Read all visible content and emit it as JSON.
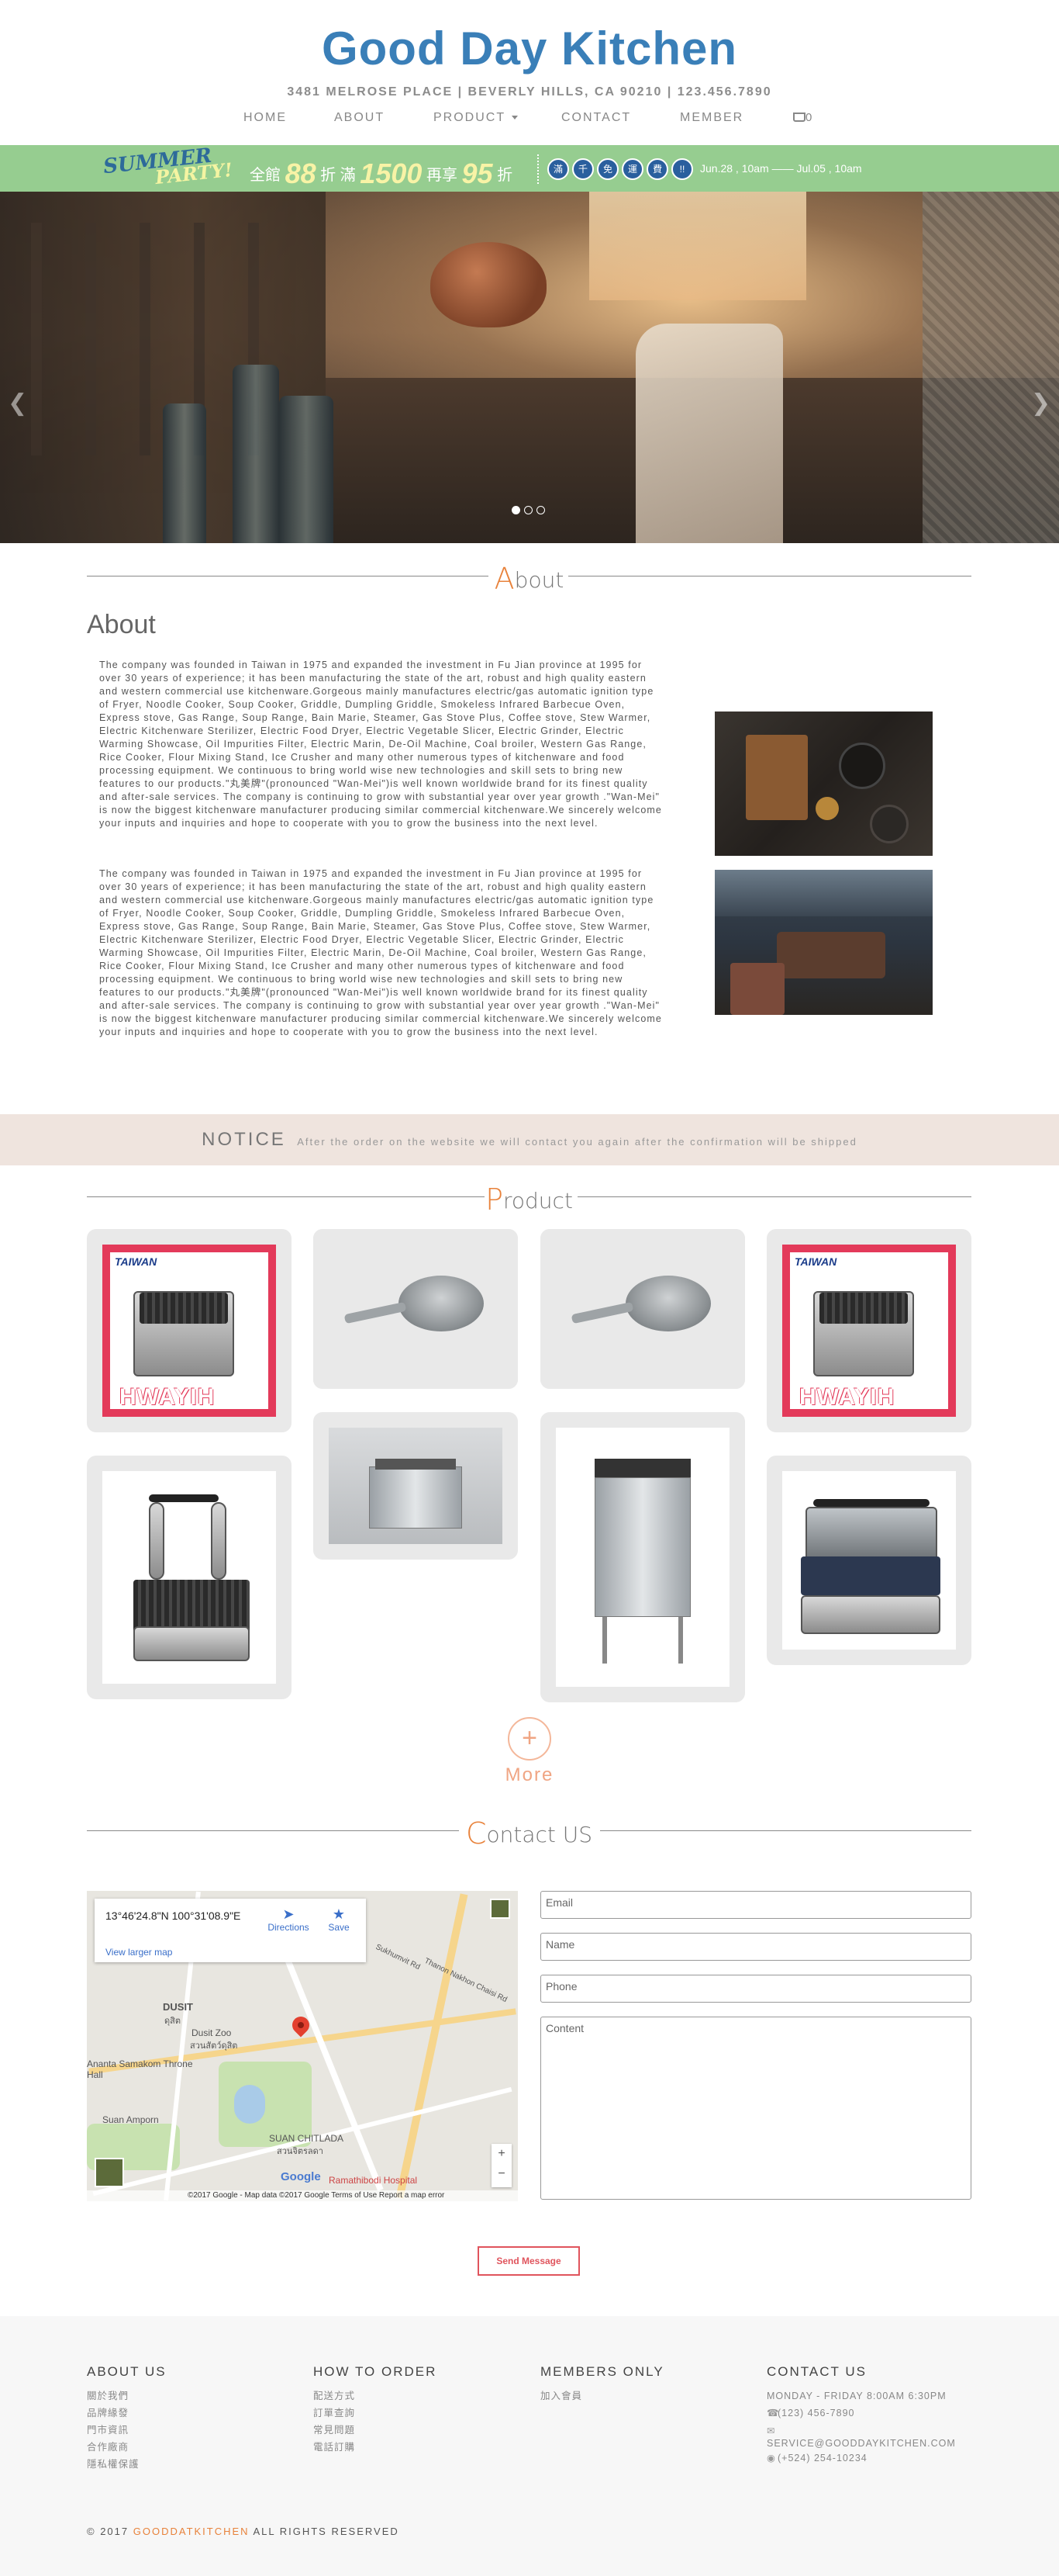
{
  "header": {
    "brand": "Good Day Kitchen",
    "address": "3481 MELROSE PLACE | BEVERLY HILLS, CA 90210 | 123.456.7890",
    "nav": [
      "HOME",
      "ABOUT",
      "PRODUCT",
      "CONTACT",
      "MEMBER"
    ],
    "cart_count": "0"
  },
  "promo": {
    "summer": "SUMMER",
    "party": "PARTY!",
    "t1": "全館",
    "n1": "88",
    "t2": "折",
    "t3": "滿",
    "n2": "1500",
    "t4": "再享",
    "n3": "95",
    "t5": "折",
    "badges": [
      "滿",
      "千",
      "免",
      "運",
      "費",
      "!!"
    ],
    "dates": "Jun.28 , 10am —— Jul.05 , 10am"
  },
  "hero": {
    "slide_count": 3,
    "active_slide": 1
  },
  "about": {
    "section_cap": "A",
    "section_rest": "bout",
    "heading": "About",
    "paragraphs": [
      "The company was founded in Taiwan in 1975 and expanded the investment in Fu Jian province at 1995 for over 30 years of experience; it has been manufacturing the state of the art, robust and high quality eastern and western commercial use kitchenware.Gorgeous mainly manufactures electric/gas automatic ignition type of Fryer, Noodle Cooker, Soup Cooker, Griddle, Dumpling Griddle, Smokeless Infrared Barbecue Oven, Express stove, Gas Range, Soup Range, Bain Marie, Steamer, Gas Stove Plus, Coffee stove, Stew Warmer, Electric Kitchenware Sterilizer, Electric Food Dryer, Electric Vegetable Slicer, Electric Grinder, Electric Warming Showcase, Oil Impurities Filter, Electric Marin, De-Oil Machine, Coal broiler, Western Gas Range, Rice Cooker, Flour Mixing Stand, Ice Crusher and many other numerous types of kitchenware and food processing equipment. We continuous to bring world wise new technologies and skill sets to bring new features to our products.\"丸美牌\"(pronounced \"Wan-Mei\")is well known worldwide brand for its finest quality and after-sale services. The company is continuing to grow with substantial year over year growth .\"Wan-Mei\" is now the biggest kitchenware manufacturer producing similar commercial kitchenware.We sincerely welcome your inputs and inquiries and hope to cooperate with you to grow the business into the next level.",
      "The company was founded in Taiwan in 1975 and expanded the investment in Fu Jian province at 1995 for over 30 years of experience; it has been manufacturing the state of the art, robust and high quality eastern and western commercial use kitchenware.Gorgeous mainly manufactures electric/gas automatic ignition type of Fryer, Noodle Cooker, Soup Cooker, Griddle, Dumpling Griddle, Smokeless Infrared Barbecue Oven, Express stove, Gas Range, Soup Range, Bain Marie, Steamer, Gas Stove Plus, Coffee stove, Stew Warmer, Electric Kitchenware Sterilizer, Electric Food Dryer, Electric Vegetable Slicer, Electric Grinder, Electric Warming Showcase, Oil Impurities Filter, Electric Marin, De-Oil Machine, Coal broiler, Western Gas Range, Rice Cooker, Flour Mixing Stand, Ice Crusher and many other numerous types of kitchenware and food processing equipment. We continuous to bring world wise new technologies and skill sets to bring new features to our products.\"丸美牌\"(pronounced \"Wan-Mei\")is well known worldwide brand for its finest quality and after-sale services. The company is continuing to grow with substantial year over year growth .\"Wan-Mei\" is now the biggest kitchenware manufacturer producing similar commercial kitchenware.We sincerely welcome your inputs and inquiries and hope to cooperate with you to grow the business into the next level."
    ]
  },
  "notice": {
    "title": "NOTICE",
    "text": "After the order on the website we will contact you again after the confirmation will be shipped"
  },
  "product": {
    "section_cap": "P",
    "section_rest": "roduct",
    "taiwan_logo": "TAIWAN",
    "hwayih_logo": "HWAYIH",
    "more_symbol": "+",
    "more_label": "More"
  },
  "contact": {
    "section_cap": "C",
    "section_rest": "ontact US",
    "map": {
      "coords": "13°46'24.8\"N 100°31'08.9\"E",
      "larger": "View larger map",
      "directions": "Directions",
      "save": "Save",
      "labels": [
        "DUSIT",
        "ดุสิต",
        "Dusit Zoo",
        "สวนสัตว์ดุสิต",
        "Ananta Samakom Throne Hall",
        "Suan Amporn",
        "SUAN CHITLADA",
        "สวนจิตรลดา",
        "Ramathibodi Hospital",
        "Sukhumvit Rd",
        "Thanon Nakhon Chaisi Rd"
      ],
      "google": "Google",
      "footer": "©2017 Google - Map data ©2017 Google    Terms of Use    Report a map error"
    },
    "fields": {
      "email": "Email",
      "name": "Name",
      "phone": "Phone",
      "content": "Content"
    },
    "send": "Send Message"
  },
  "footer": {
    "cols": [
      {
        "title": "ABOUT US",
        "links": [
          "關於我們",
          "品牌緣發",
          "門市資訊",
          "合作廠商",
          "隱私權保護"
        ]
      },
      {
        "title": "HOW TO ORDER",
        "links": [
          "配送方式",
          "訂單查詢",
          "常見問題",
          "電話訂購"
        ]
      },
      {
        "title": "MEMBERS ONLY",
        "links": [
          "加入會員"
        ]
      },
      {
        "title": "CONTACT US",
        "links": [
          "MONDAY - FRIDAY 8:00AM 6:30PM",
          "(123) 456-7890",
          "SERVICE@GOODDAYKITCHEN.COM",
          "(+524) 254-10234"
        ]
      }
    ],
    "copy_pre": "© 2017",
    "copy_brand": "GOODDATKITCHEN",
    "copy_post": "ALL RIGHTS RESERVED"
  },
  "colors": {
    "brand_blue": "#3a7fb8",
    "accent_orange": "#e8823b",
    "promo_green": "#96cd90",
    "notice_bg": "#efe4de",
    "send_red": "#e0545d"
  }
}
